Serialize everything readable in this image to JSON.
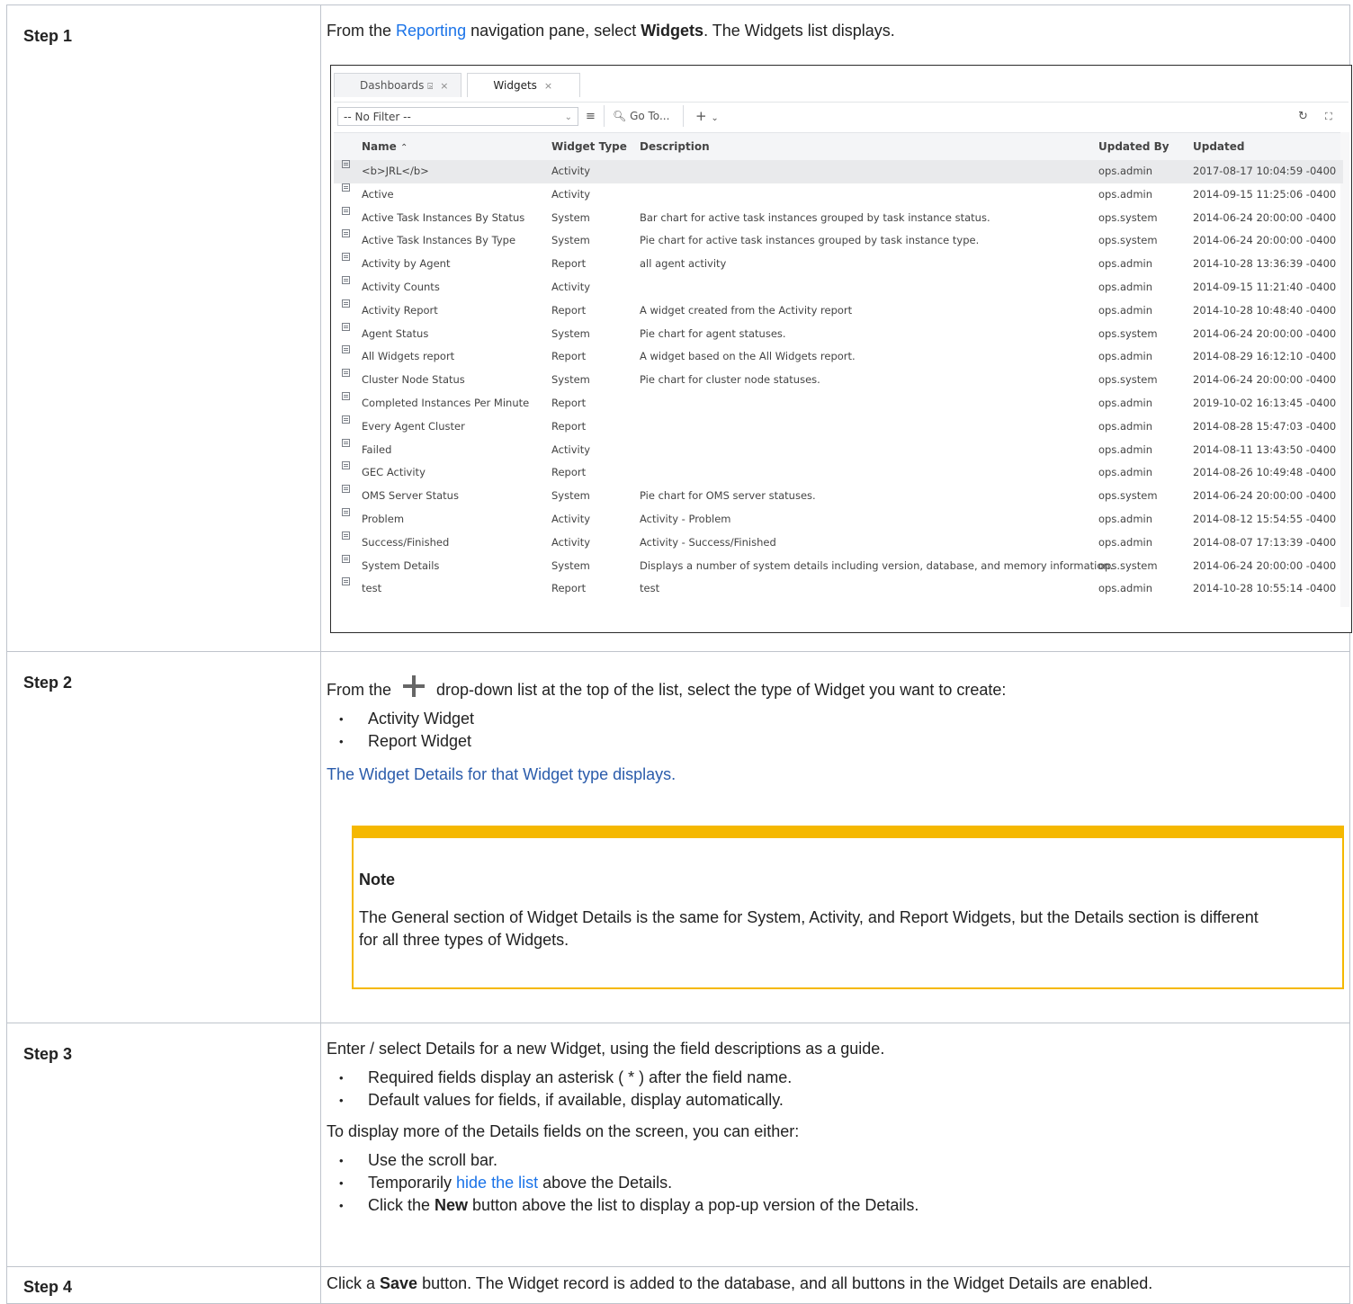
{
  "steps": [
    {
      "label": "Step 1",
      "intro_prefix": "From the ",
      "intro_link": "Reporting",
      "intro_mid": " navigation pane, select ",
      "intro_bold": "Widgets",
      "intro_suffix": ". The Widgets list displays."
    },
    {
      "label": "Step 2",
      "intro_prefix": "From the",
      "intro_suffix": "drop-down list at the top of the list, select the type of Widget you want to create:",
      "bullets": [
        "Activity Widget",
        "Report Widget"
      ],
      "result": "The Widget Details for that Widget type displays."
    },
    {
      "label": "Step 3",
      "intro": "Enter / select Details for a new Widget, using the field descriptions as a guide.",
      "bullets": [
        "Required fields display an asterisk ( * ) after the field name.",
        "Default values for fields, if available, display automatically."
      ],
      "more": "To display more of the Details fields on the screen, you can either:",
      "bullets2": {
        "b1": "Use the scroll bar.",
        "b2_prefix": "Temporarily ",
        "b2_link": "hide the list",
        "b2_suffix": " above the Details.",
        "b3_prefix": "Click the ",
        "b3_bold": "New",
        "b3_suffix": " button above the list to display a pop-up version of the Details."
      }
    },
    {
      "label": "Step 4",
      "prefix": "Click a ",
      "bold": "Save",
      "suffix": " button. The Widget record is added to the database, and all buttons in the Widget Details are enabled."
    }
  ],
  "note": {
    "title": "Note",
    "body": "The General section of Widget Details is the same for System, Activity, and Report Widgets, but the Details section is different for all three types of Widgets."
  },
  "app": {
    "tabs": [
      {
        "label": "Dashboards",
        "pin": "⍄",
        "close": "×"
      },
      {
        "label": "Widgets",
        "close": "×"
      }
    ],
    "filter": "-- No Filter --",
    "goto": "Go To...",
    "columns": {
      "name": "Name",
      "type": "Widget Type",
      "desc": "Description",
      "by": "Updated By",
      "updated": "Updated"
    },
    "rows": [
      {
        "name": "<b>JRL</b>",
        "type": "Activity",
        "desc": "",
        "by": "ops.admin",
        "updated": "2017-08-17 10:04:59 -0400"
      },
      {
        "name": "Active",
        "type": "Activity",
        "desc": "",
        "by": "ops.admin",
        "updated": "2014-09-15 11:25:06 -0400"
      },
      {
        "name": "Active Task Instances By Status",
        "type": "System",
        "desc": "Bar chart for active task instances grouped by task instance status.",
        "by": "ops.system",
        "updated": "2014-06-24 20:00:00 -0400"
      },
      {
        "name": "Active Task Instances By Type",
        "type": "System",
        "desc": "Pie chart for active task instances grouped by task instance type.",
        "by": "ops.system",
        "updated": "2014-06-24 20:00:00 -0400"
      },
      {
        "name": "Activity by Agent",
        "type": "Report",
        "desc": "all agent activity",
        "by": "ops.admin",
        "updated": "2014-10-28 13:36:39 -0400"
      },
      {
        "name": "Activity Counts",
        "type": "Activity",
        "desc": "",
        "by": "ops.admin",
        "updated": "2014-09-15 11:21:40 -0400"
      },
      {
        "name": "Activity Report",
        "type": "Report",
        "desc": "A widget created from the Activity report",
        "by": "ops.admin",
        "updated": "2014-10-28 10:48:40 -0400"
      },
      {
        "name": "Agent Status",
        "type": "System",
        "desc": "Pie chart for agent statuses.",
        "by": "ops.system",
        "updated": "2014-06-24 20:00:00 -0400"
      },
      {
        "name": "All Widgets report",
        "type": "Report",
        "desc": "A widget based on the All Widgets report.",
        "by": "ops.admin",
        "updated": "2014-08-29 16:12:10 -0400"
      },
      {
        "name": "Cluster Node Status",
        "type": "System",
        "desc": "Pie chart for cluster node statuses.",
        "by": "ops.system",
        "updated": "2014-06-24 20:00:00 -0400"
      },
      {
        "name": "Completed Instances Per Minute",
        "type": "Report",
        "desc": "",
        "by": "ops.admin",
        "updated": "2019-10-02 16:13:45 -0400"
      },
      {
        "name": "Every Agent Cluster",
        "type": "Report",
        "desc": "",
        "by": "ops.admin",
        "updated": "2014-08-28 15:47:03 -0400"
      },
      {
        "name": "Failed",
        "type": "Activity",
        "desc": "",
        "by": "ops.admin",
        "updated": "2014-08-11 13:43:50 -0400"
      },
      {
        "name": "GEC Activity",
        "type": "Report",
        "desc": "",
        "by": "ops.admin",
        "updated": "2014-08-26 10:49:48 -0400"
      },
      {
        "name": "OMS Server Status",
        "type": "System",
        "desc": "Pie chart for OMS server statuses.",
        "by": "ops.system",
        "updated": "2014-06-24 20:00:00 -0400"
      },
      {
        "name": "Problem",
        "type": "Activity",
        "desc": "Activity - Problem",
        "by": "ops.admin",
        "updated": "2014-08-12 15:54:55 -0400"
      },
      {
        "name": "Success/Finished",
        "type": "Activity",
        "desc": "Activity - Success/Finished",
        "by": "ops.admin",
        "updated": "2014-08-07 17:13:39 -0400"
      },
      {
        "name": "System Details",
        "type": "System",
        "desc": "Displays a number of system details including version, database, and memory information.",
        "by": "ops.system",
        "updated": "2014-06-24 20:00:00 -0400"
      },
      {
        "name": "test",
        "type": "Report",
        "desc": "test",
        "by": "ops.admin",
        "updated": "2014-10-28 10:55:14 -0400"
      }
    ]
  }
}
